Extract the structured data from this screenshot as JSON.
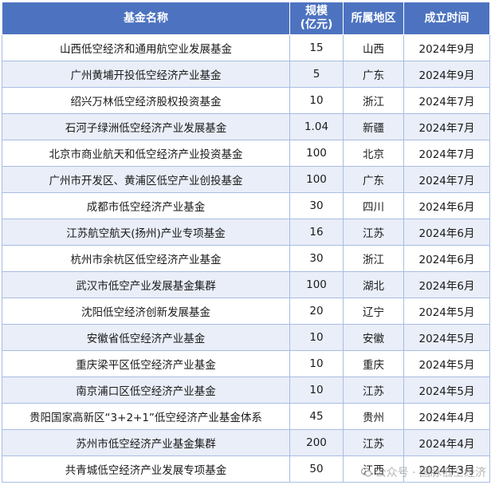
{
  "table": {
    "headers": {
      "name": "基金名称",
      "scale_line1": "规模",
      "scale_line2": "(亿元)",
      "region": "所属地区",
      "date": "成立时间"
    },
    "rows": [
      {
        "name": "山西低空经济和通用航空业发展基金",
        "scale": "15",
        "region": "山西",
        "date": "2024年9月"
      },
      {
        "name": "广州黄埔开投低空经济产业基金",
        "scale": "5",
        "region": "广东",
        "date": "2024年9月"
      },
      {
        "name": "绍兴万林低空经济股权投资基金",
        "scale": "10",
        "region": "浙江",
        "date": "2024年7月"
      },
      {
        "name": "石河子绿洲低空经济产业发展基金",
        "scale": "1.04",
        "region": "新疆",
        "date": "2024年7月"
      },
      {
        "name": "北京市商业航天和低空经济产业投资基金",
        "scale": "100",
        "region": "北京",
        "date": "2024年7月"
      },
      {
        "name": "广州市开发区、黄浦区低空产业创投基金",
        "scale": "100",
        "region": "广东",
        "date": "2024年7月"
      },
      {
        "name": "成都市低空经济产业基金",
        "scale": "30",
        "region": "四川",
        "date": "2024年6月"
      },
      {
        "name": "江苏航空航天(扬州)产业专项基金",
        "scale": "16",
        "region": "江苏",
        "date": "2024年6月"
      },
      {
        "name": "杭州市余杭区低空经济产业基金",
        "scale": "30",
        "region": "浙江",
        "date": "2024年6月"
      },
      {
        "name": "武汉市低空产业发展基金集群",
        "scale": "100",
        "region": "湖北",
        "date": "2024年6月"
      },
      {
        "name": "沈阳低空经济创新发展基金",
        "scale": "20",
        "region": "辽宁",
        "date": "2024年5月"
      },
      {
        "name": "安徽省低空经济产业基金",
        "scale": "10",
        "region": "安徽",
        "date": "2024年5月"
      },
      {
        "name": "重庆梁平区低空经济产业基金",
        "scale": "10",
        "region": "重庆",
        "date": "2024年5月"
      },
      {
        "name": "南京浦口区低空经济产业基金",
        "scale": "10",
        "region": "江苏",
        "date": "2024年5月"
      },
      {
        "name": "贵阳国家高新区“3+2+1”低空经济产业基金体系",
        "scale": "45",
        "region": "贵州",
        "date": "2024年4月"
      },
      {
        "name": "苏州市低空经济产业基金集群",
        "scale": "200",
        "region": "江苏",
        "date": "2024年4月"
      },
      {
        "name": "共青城低空经济产业发展专项基金",
        "scale": "50",
        "region": "江西",
        "date": "2024年3月"
      }
    ]
  },
  "watermark": {
    "text": "公众号 · 国脉低空经济",
    "icon": "wechat-icon"
  }
}
